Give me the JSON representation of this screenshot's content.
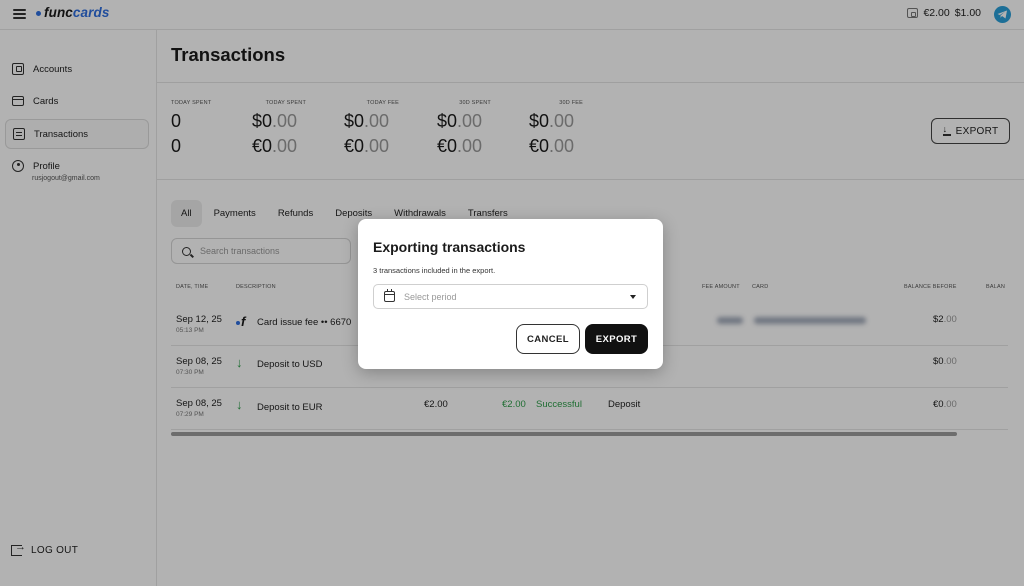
{
  "header": {
    "logo_func": "func",
    "logo_cards": "cards",
    "balance_eur": "€2.00",
    "balance_usd": "$1.00"
  },
  "sidebar": {
    "items": [
      {
        "label": "Accounts"
      },
      {
        "label": "Cards"
      },
      {
        "label": "Transactions"
      },
      {
        "label": "Profile"
      }
    ],
    "profile_email": "rusjogout@gmail.com",
    "logout_label": "LOG OUT"
  },
  "page": {
    "title": "Transactions",
    "export_label": "EXPORT"
  },
  "stats": [
    {
      "label": "TODAY SPENT",
      "row1": "0",
      "row2": "0"
    },
    {
      "label": "TODAY SPENT",
      "row1_int": "$0",
      "row1_dec": ".00",
      "row2_int": "€0",
      "row2_dec": ".00"
    },
    {
      "label": "TODAY FEE",
      "row1_int": "$0",
      "row1_dec": ".00",
      "row2_int": "€0",
      "row2_dec": ".00"
    },
    {
      "label": "30D SPENT",
      "row1_int": "$0",
      "row1_dec": ".00",
      "row2_int": "€0",
      "row2_dec": ".00"
    },
    {
      "label": "30D FEE",
      "row1_int": "$0",
      "row1_dec": ".00",
      "row2_int": "€0",
      "row2_dec": ".00"
    }
  ],
  "tabs": [
    "All",
    "Payments",
    "Refunds",
    "Deposits",
    "Withdrawals",
    "Transfers"
  ],
  "search": {
    "placeholder": "Search transactions"
  },
  "table": {
    "headers": {
      "date": "DATE, TIME",
      "description": "DESCRIPTION",
      "fee_amount": "FEE AMOUNT",
      "card": "CARD",
      "balance_before": "BALANCE BEFORE",
      "balance": "BALAN"
    },
    "rows": [
      {
        "date": "Sep 12, 25",
        "time": "05:13 PM",
        "description": "Card issue fee •• 6670",
        "amount": "",
        "fee": "",
        "status": "",
        "type": "",
        "balance_before_int": "$2",
        "balance_before_dec": ".00"
      },
      {
        "date": "Sep 08, 25",
        "time": "07:30 PM",
        "description": "Deposit to USD",
        "amount": "",
        "fee": "",
        "status": "",
        "type": "",
        "balance_before_int": "$0",
        "balance_before_dec": ".00"
      },
      {
        "date": "Sep 08, 25",
        "time": "07:29 PM",
        "description": "Deposit to EUR",
        "amount": "€2.00",
        "fee": "€2.00",
        "status": "Successful",
        "type": "Deposit",
        "balance_before_int": "€0",
        "balance_before_dec": ".00"
      }
    ]
  },
  "modal": {
    "title": "Exporting transactions",
    "subtitle": "3 transactions included in the export.",
    "period_placeholder": "Select period",
    "cancel_label": "CANCEL",
    "export_label": "EXPORT"
  },
  "colors": {
    "accent": "#2f6fe0",
    "success": "#2e9e4a",
    "primary_button": "#111111",
    "overlay": "rgba(0,0,0,0.30)"
  }
}
